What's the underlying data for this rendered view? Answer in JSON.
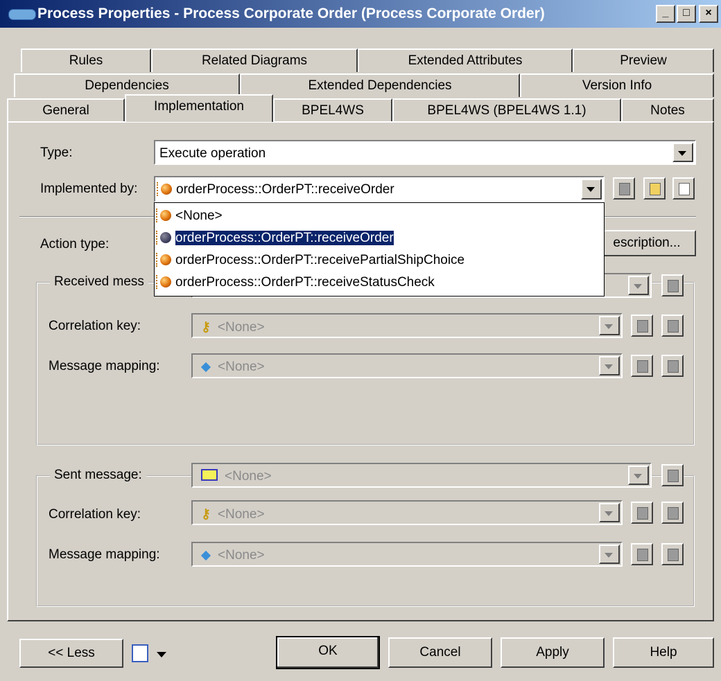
{
  "window": {
    "title": "Process Properties - Process Corporate Order (Process Corporate Order)",
    "minimize": "_",
    "maximize": "□",
    "close": "×"
  },
  "tabs": {
    "row1": [
      "Rules",
      "Related Diagrams",
      "Extended Attributes",
      "Preview"
    ],
    "row2": [
      "Dependencies",
      "Extended Dependencies",
      "Version Info"
    ],
    "row3": [
      "General",
      "Implementation",
      "BPEL4WS",
      "BPEL4WS (BPEL4WS 1.1)",
      "Notes"
    ]
  },
  "form": {
    "type_label": "Type:",
    "type_value": "Execute operation",
    "implemented_by_label": "Implemented by:",
    "implemented_by_value": "orderProcess::OrderPT::receiveOrder",
    "action_type_label": "Action type:",
    "description_button": "escription..."
  },
  "dropdown": {
    "items": [
      "<None>",
      "orderProcess::OrderPT::receiveOrder",
      "orderProcess::OrderPT::receivePartialShipChoice",
      "orderProcess::OrderPT::receiveStatusCheck"
    ]
  },
  "received": {
    "legend": "Received mess",
    "correlation_label": "Correlation key:",
    "correlation_value": "<None>",
    "mapping_label": "Message mapping:",
    "mapping_value": "<None>"
  },
  "sent": {
    "legend": "Sent message:",
    "message_value": "<None>",
    "correlation_label": "Correlation key:",
    "correlation_value": "<None>",
    "mapping_label": "Message mapping:",
    "mapping_value": "<None>"
  },
  "buttons": {
    "less": "<< Less",
    "ok": "OK",
    "cancel": "Cancel",
    "apply": "Apply",
    "help": "Help"
  },
  "colors": {
    "title_start": "#0a246a",
    "title_end": "#a6caf0",
    "selection": "#0a246a",
    "face": "#d4d0c8"
  }
}
